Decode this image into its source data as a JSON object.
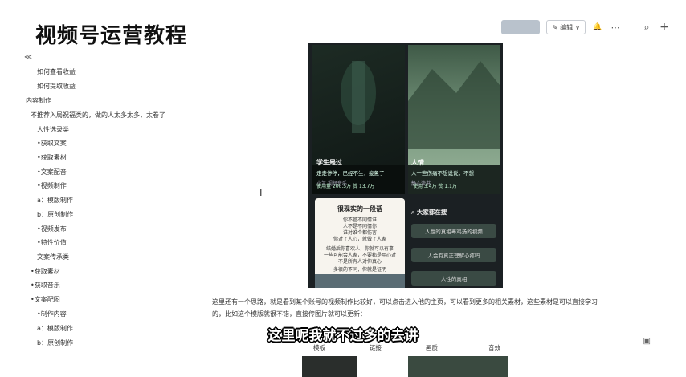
{
  "header": {
    "title": "视频号运营教程",
    "share_label": "",
    "edit_label": "编辑",
    "edit_caret": "∨"
  },
  "icons": {
    "collapse": "≪",
    "edit": "✎",
    "bell": "🔔",
    "more": "⋯",
    "search": "⌕",
    "add": "+",
    "feedback": "▣"
  },
  "sidebar": {
    "items": [
      {
        "label": "如何查看收益"
      },
      {
        "label": "如何提取收益"
      },
      {
        "label": "内容制作"
      },
      {
        "label": "不推荐入局祝福类的，做的人太多太多，太卷了"
      },
      {
        "label": "人性选录类"
      },
      {
        "label": "•获取文案"
      },
      {
        "label": "•获取素材"
      },
      {
        "label": "•文案配音"
      },
      {
        "label": "•视频制作"
      },
      {
        "label": "a：模版制作"
      },
      {
        "label": "b：原创制作"
      },
      {
        "label": "•视频发布"
      },
      {
        "label": "•特性价值"
      },
      {
        "label": "文案传承类"
      },
      {
        "label": "•获取素材"
      },
      {
        "label": "•获取音乐"
      },
      {
        "label": "•文案配图"
      },
      {
        "label": "•制作内容"
      },
      {
        "label": "a：模版制作"
      },
      {
        "label": "b：原创制作"
      }
    ]
  },
  "screenshot": {
    "card_left": {
      "meta": "使用量 200.5万  赞 13.7万",
      "title": "学生是过",
      "sub": "走走停停，已经不生，疲惫了",
      "user": "小羊 视频音乐"
    },
    "card_right": {
      "meta": "使用 3.4万  赞 1.1万",
      "title": "人情",
      "sub": "人一些伤痛不想说说，不想",
      "user": "静心读书"
    },
    "quote": {
      "title": "很现实的一段话",
      "lines": [
        "你不管不同情谁",
        "人不是不同情你",
        "谁对谁个都伤害",
        "你对了人心，就做了人家",
        "",
        "结婚后你喜欢人，你就可以有事",
        "一些可能会人家，不要都是用心对",
        "不是所有人对你真心",
        "",
        "多很的不同，你就是证明"
      ]
    },
    "search_title": "大家都在搜",
    "search_items": [
      "人性的真相毒鸡汤的视频",
      "人会有真正理解心疼吗",
      "人性的真相"
    ]
  },
  "content": {
    "paragraph": "这里还有一个思路，就是看到某个账号的视频制作比较好，可以点击进入他的主页，可以看到更多的相关素材，这些素材是可以直接学习的，比如这个模版就很不错，直接传图片就可以更新："
  },
  "subtitle": "这里呢我就不过多的去讲",
  "bottom_strip": {
    "labels": [
      "模板",
      "链接",
      "画质",
      "音效"
    ]
  }
}
